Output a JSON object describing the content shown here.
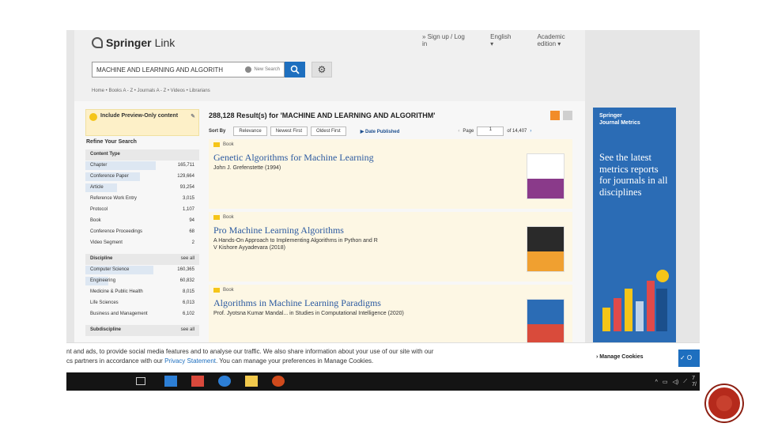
{
  "site": {
    "logo_text": "Springer",
    "logo_text2": "Link",
    "top_links": [
      "» Sign up / Log in",
      "English ▾",
      "Academic edition ▾"
    ]
  },
  "search": {
    "value": "MACHINE AND LEARNING AND ALGORITH",
    "new_search_label": "New Search"
  },
  "nav": {
    "breadcrumb": "Home  •  Books A - Z  •  Journals A - Z  •  Videos  •  Librarians"
  },
  "sidebar": {
    "preview_label": "Include Preview-Only content",
    "refine_title": "Refine Your Search",
    "content_type_title": "Content Type",
    "content_types": [
      {
        "label": "Chapter",
        "count": "165,711",
        "fill": 0.62
      },
      {
        "label": "Conference Paper",
        "count": "129,664",
        "fill": 0.48
      },
      {
        "label": "Article",
        "count": "93,254",
        "fill": 0.28
      },
      {
        "label": "Reference Work Entry",
        "count": "3,015",
        "fill": 0
      },
      {
        "label": "Protocol",
        "count": "1,107",
        "fill": 0
      },
      {
        "label": "Book",
        "count": "94",
        "fill": 0
      },
      {
        "label": "Conference Proceedings",
        "count": "68",
        "fill": 0
      },
      {
        "label": "Video Segment",
        "count": "2",
        "fill": 0
      }
    ],
    "discipline_title": "Discipline",
    "discipline_see_all": "see all",
    "disciplines": [
      {
        "label": "Computer Science",
        "count": "160,365",
        "fill": 0.6
      },
      {
        "label": "Engineering",
        "count": "60,832",
        "fill": 0.2
      },
      {
        "label": "Medicine & Public Health",
        "count": "8,015",
        "fill": 0
      },
      {
        "label": "Life Sciences",
        "count": "6,013",
        "fill": 0
      },
      {
        "label": "Business and Management",
        "count": "6,102",
        "fill": 0
      }
    ],
    "subdiscipline_title": "Subdiscipline",
    "subdiscipline_see_all": "see all"
  },
  "results": {
    "count": "288,128",
    "query": "Result(s) for 'MACHINE AND LEARNING AND ALGORITHM'",
    "sort_by_label": "Sort By",
    "sort_options": [
      "Relevance",
      "Newest First",
      "Oldest First"
    ],
    "date_published_label": "Date Published",
    "page_label": "Page",
    "page_value": "1",
    "page_of": "of 14,407",
    "items": [
      {
        "type": "Book",
        "title": "Genetic Algorithms for Machine Learning",
        "subtitle": "",
        "authors": "John J. Grefenstette (1994)"
      },
      {
        "type": "Book",
        "title": "Pro Machine Learning Algorithms",
        "subtitle": "A Hands-On Approach to Implementing Algorithms in Python and R",
        "authors": "V Kishore Ayyadevara (2018)"
      },
      {
        "type": "Book",
        "title": "Algorithms in Machine Learning Paradigms",
        "subtitle": "",
        "authors": "Prof. Jyotsna Kumar Mandal... in Studies in Computational Intelligence (2020)"
      }
    ]
  },
  "ad": {
    "brand_line1": "Springer",
    "brand_line2": "Journal Metrics",
    "message": "See the latest metrics reports for journals in all disciplines"
  },
  "cookie": {
    "line1": "nt and ads, to provide social media features and to analyse our traffic. We also share information about your use of our site with our",
    "line2_pre": "cs partners in accordance with our",
    "privacy_link": "Privacy Statement",
    "line2_post": ". You can manage your preferences in Manage Cookies.",
    "manage_label": "Manage Cookies",
    "accept_label": "✓ O"
  },
  "taskbar": {
    "time": "7",
    "date": "7/"
  },
  "colors": {
    "accent": "#1e6fbf",
    "ad_blue": "#2b6cb5",
    "result_bg": "#fdf7e4",
    "badge": "#b52a1c"
  }
}
